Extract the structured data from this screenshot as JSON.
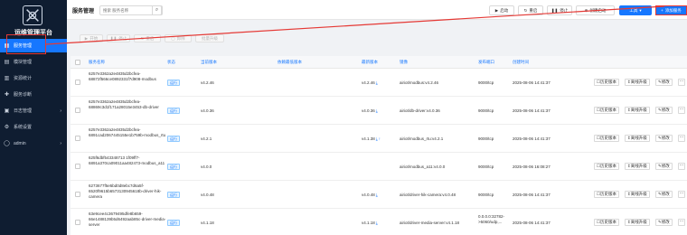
{
  "sidebar": {
    "app_title": "运维管理平台",
    "items": [
      {
        "label": "服务管理",
        "icon": "grid-icon",
        "active": true
      },
      {
        "label": "模块管理",
        "icon": "modules-icon"
      },
      {
        "label": "资源统计",
        "icon": "chart-icon"
      },
      {
        "label": "服务诊断",
        "icon": "diagnosis-icon"
      },
      {
        "label": "日志管理",
        "icon": "log-icon",
        "has_arrow": true
      },
      {
        "label": "系统设置",
        "icon": "gear-icon"
      },
      {
        "label": "admin",
        "icon": "user-icon",
        "has_arrow": true
      }
    ]
  },
  "topbar": {
    "title": "服务管理",
    "search_placeholder": "搜索 服务名称",
    "buttons": {
      "start": "启动",
      "restart": "重启",
      "stop": "停止",
      "create_start": "创建启动",
      "tools": "工具",
      "add_service": "添加服务"
    }
  },
  "subtoolbar": {
    "start": "开始",
    "stop": "停止",
    "restart": "重启",
    "uninstall": "卸除",
    "batch": "批量升级"
  },
  "table": {
    "headers": [
      "服务名称",
      "状态",
      "当前版本",
      "依赖最低版本",
      "最新版本",
      "镜像",
      "发布端口",
      "创建时间"
    ],
    "rows": [
      {
        "name": "6257e3362a2e4835d2bcfea-68872f566ce0892331f7d908-modbus",
        "status": "运行",
        "current": "v4.2.46",
        "latest": "v4.2.46",
        "mirror": "airiot/modbus:v4.2.46",
        "port": "9000/tcp",
        "time": "2025-08-06 14:41:37"
      },
      {
        "name": "6257e3362a2e4835d2bcfea-68869c3d1f171a28015e3453-db-driver",
        "status": "运行",
        "current": "v4.0.36",
        "latest": "v4.0.36",
        "mirror": "airiot/db-driver:v4.0.36",
        "port": "9000/tcp",
        "time": "2025-08-06 14:41:37"
      },
      {
        "name": "6257e3362a2e4835d2bcfea-6891cad2067445155e1b759b-modbus_rtu",
        "status": "运行",
        "current": "v4.2.1",
        "latest": "v4.1.38",
        "mirror": "airiot/modbus_rtu:v4.2.1",
        "port": "9000/tcp",
        "time": "2025-08-06 14:41:37"
      },
      {
        "name": "625f6dbf543348713 1f09ff7-6891a370ca09011aa482473-modbus_a11",
        "status": "运行",
        "current": "v4.0.0",
        "latest": "",
        "mirror": "airiot/modbus_a11:v4.0.0",
        "port": "9000/tcp",
        "time": "2025-08-06 16:08:27"
      },
      {
        "name": "6273677f5e5bd0d8ebc7d6a5f-6520f9615b6573130945618b-driver-hik-camera",
        "status": "运行",
        "current": "v4.0.48",
        "latest": "v4.0.48",
        "mirror": "airiot/driver-hik-camera:v4.0.48",
        "port": "9000/tcp",
        "time": "2025-08-06 14:41:37"
      },
      {
        "name": "63e9cee4c3679495dfe8b659-66e1488139b5d6492aab85c-driver-media-server",
        "status": "运行",
        "current": "v4.1.18",
        "latest": "v4.1.18",
        "mirror": "airiot/driver-media-server:v4.1.18",
        "port": "0.0.0.0:32782->5060/udp,...",
        "time": "2025-08-06 14:41:37"
      }
    ],
    "actions": {
      "history": "历史版本",
      "offline_upgrade": "离线升级",
      "edit": "修改",
      "more": "···"
    }
  },
  "colors": {
    "sidebar_bg": "#0f1d31",
    "accent": "#1677ff",
    "annotation": "#e53935"
  }
}
